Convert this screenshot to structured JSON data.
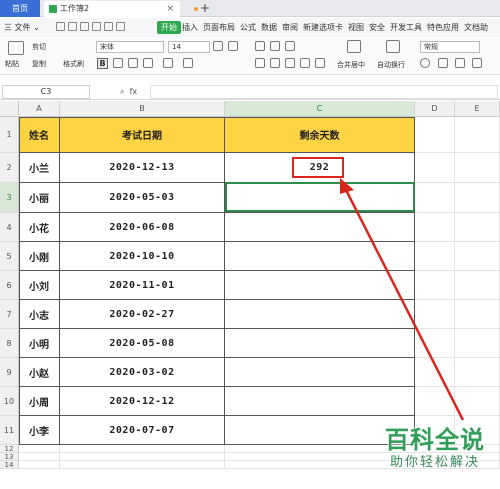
{
  "tabs": {
    "home": "首页",
    "document": "工作簿2",
    "add": "+",
    "close": "×"
  },
  "menu": {
    "file": "三 文件 ⌄",
    "start": "开始",
    "items": [
      "插入",
      "页面布局",
      "公式",
      "数据",
      "审阅",
      "新建选项卡",
      "视图",
      "安全",
      "开发工具",
      "特色应用",
      "文档助"
    ]
  },
  "ribbon": {
    "cut": "剪切",
    "paste": "粘贴",
    "copy": "复制",
    "format_painter": "格式刷",
    "font_name": "宋体",
    "font_size": "14",
    "merge_center": "合并居中",
    "auto_wrap": "自动换行",
    "number_format": "常规",
    "bold": "B"
  },
  "formula_bar": {
    "cell_ref": "C3",
    "fx": "fx"
  },
  "columns": [
    "A",
    "B",
    "C",
    "D",
    "E"
  ],
  "rows": [
    "1",
    "2",
    "3",
    "4",
    "5",
    "6",
    "7",
    "8",
    "9",
    "10",
    "11",
    "12",
    "13",
    "14"
  ],
  "table": {
    "headers": [
      "姓名",
      "考试日期",
      "剩余天数"
    ],
    "records": [
      {
        "name": "小兰",
        "date": "2020-12-13",
        "days": "292"
      },
      {
        "name": "小丽",
        "date": "2020-05-03",
        "days": ""
      },
      {
        "name": "小花",
        "date": "2020-06-08",
        "days": ""
      },
      {
        "name": "小刚",
        "date": "2020-10-10",
        "days": ""
      },
      {
        "name": "小刘",
        "date": "2020-11-01",
        "days": ""
      },
      {
        "name": "小志",
        "date": "2020-02-27",
        "days": ""
      },
      {
        "name": "小明",
        "date": "2020-05-08",
        "days": ""
      },
      {
        "name": "小赵",
        "date": "2020-03-02",
        "days": ""
      },
      {
        "name": "小周",
        "date": "2020-12-12",
        "days": ""
      },
      {
        "name": "小李",
        "date": "2020-07-07",
        "days": ""
      }
    ]
  },
  "watermark": {
    "main": "百科全说",
    "sub": "助你轻松解决"
  },
  "colors": {
    "header_fill": "#fdd343",
    "active_border": "#2e8b4b",
    "highlight_border": "#d8281e",
    "accent_green": "#2fa84f"
  }
}
